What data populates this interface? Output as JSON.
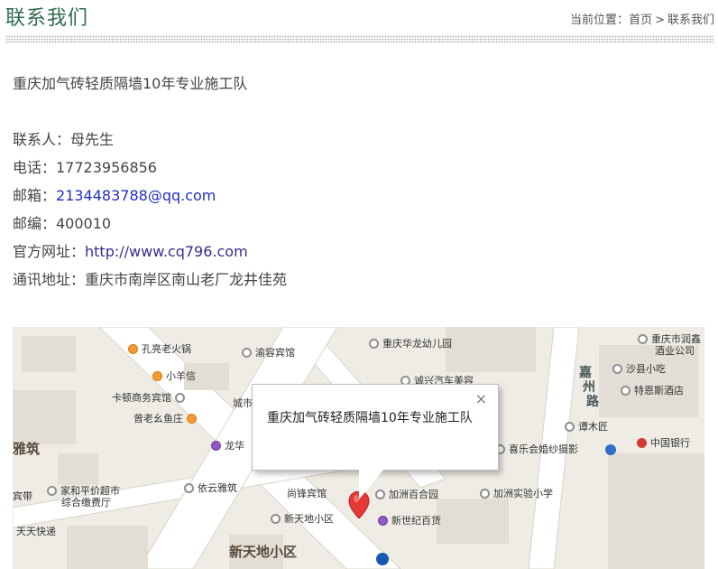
{
  "header": {
    "title": "联系我们",
    "breadcrumb_label": "当前位置：",
    "breadcrumb_home": "首页",
    "breadcrumb_sep": ">",
    "breadcrumb_current": "联系我们"
  },
  "company": {
    "name": "重庆加气砖轻质隔墙10年专业施工队"
  },
  "contact": {
    "person": "联系人：母先生",
    "phone": "电话：17723956856",
    "email_label": "邮箱：",
    "email": "2134483788@qq.com",
    "zip": "邮编：400010",
    "site_label": "官方网址：",
    "site": "http://www.cq796.com",
    "address": "通讯地址：重庆市南岸区南山老厂龙井佳苑"
  },
  "map": {
    "popup_text": "重庆加气砖轻质隔墙10年专业施工队",
    "close_symbol": "×",
    "pois": [
      {
        "label": "孔亮老火锅",
        "icon": "orange"
      },
      {
        "label": "渝容宾馆",
        "icon": "grey"
      },
      {
        "label": "重庆华龙幼儿园",
        "icon": "grey"
      },
      {
        "label": "重庆市润鑫",
        "icon": "grey"
      },
      {
        "label": "酒业公司",
        "icon": "none"
      },
      {
        "label": "小羊信",
        "icon": "orange"
      },
      {
        "label": "诚兴汽车美容",
        "icon": "grey"
      },
      {
        "label": "沙县小吃",
        "icon": "grey"
      },
      {
        "label": "卡顿商务宾馆",
        "icon": "grey"
      },
      {
        "label": "城市",
        "icon": "none"
      },
      {
        "label": "特恩斯酒店",
        "icon": "grey"
      },
      {
        "label": "嘉",
        "icon": "none"
      },
      {
        "label": "州",
        "icon": "none"
      },
      {
        "label": "路",
        "icon": "none"
      },
      {
        "label": "曾老幺鱼庄",
        "icon": "orange"
      },
      {
        "label": "谭木匠",
        "icon": "grey"
      },
      {
        "label": "雅筑",
        "icon": "none"
      },
      {
        "label": "龙华",
        "icon": "purple"
      },
      {
        "label": "喜乐会婚纱摄影",
        "icon": "grey"
      },
      {
        "label": "中国银行",
        "icon": "red"
      },
      {
        "label": "宾带",
        "icon": "none"
      },
      {
        "label": "家和平价超市",
        "icon": "grey"
      },
      {
        "label": "综合缴费厅",
        "icon": "none"
      },
      {
        "label": "依云雅筑",
        "icon": "grey"
      },
      {
        "label": "尚锋宾馆",
        "icon": "none"
      },
      {
        "label": "加洲百合园",
        "icon": "grey"
      },
      {
        "label": "加洲实验小学",
        "icon": "grey"
      },
      {
        "label": "新天地小区",
        "icon": "grey"
      },
      {
        "label": "新世纪百货",
        "icon": "purple"
      },
      {
        "label": "天天快递",
        "icon": "none"
      },
      {
        "label": "新天地小区",
        "icon": "none"
      }
    ]
  },
  "colors": {
    "title": "#2f6b4f",
    "email_link": "#1f2fbf",
    "site_link": "#3c2a91",
    "map_bg": "#f0ede6",
    "marker": "#e53935"
  }
}
